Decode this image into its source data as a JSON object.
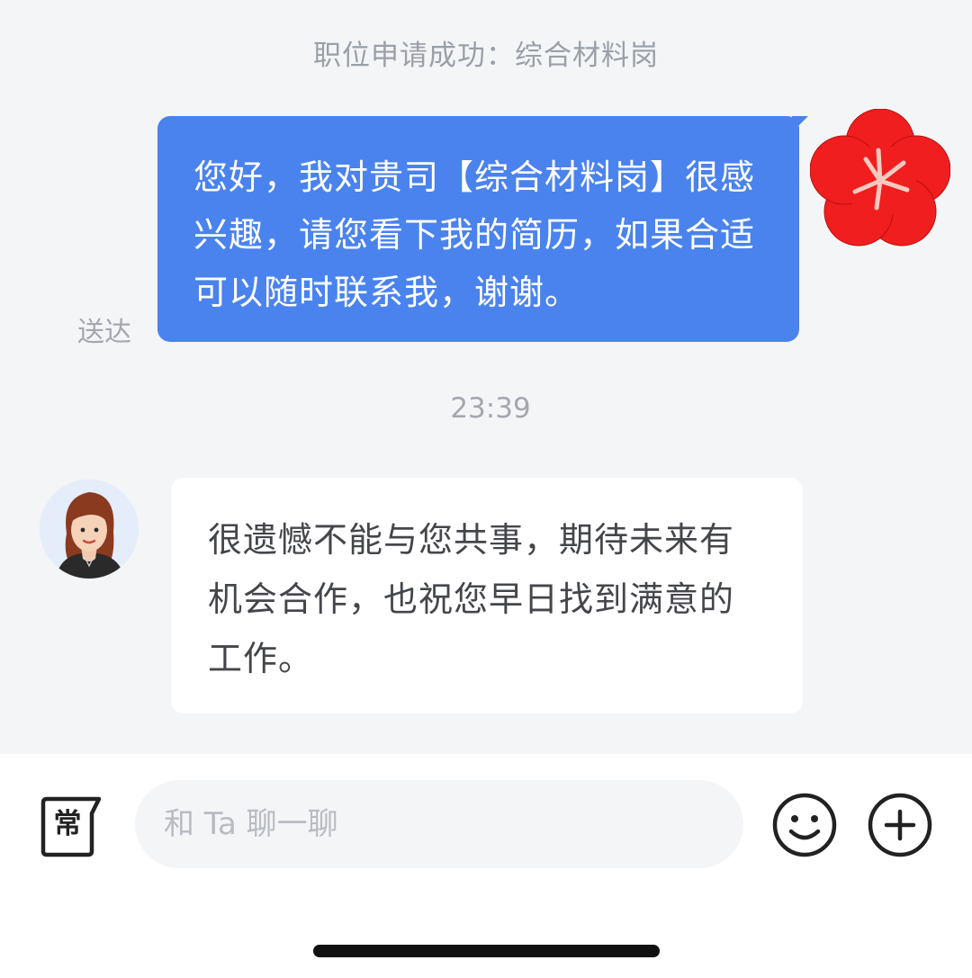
{
  "system_notice": "职位申请成功：综合材料岗",
  "messages": {
    "outgoing": {
      "text": "您好，我对贵司【综合材料岗】很感兴趣，请您看下我的简历，如果合适可以随时联系我，谢谢。",
      "status": "送达",
      "color": "#4a83ee"
    },
    "timestamp": "23:39",
    "incoming": {
      "text": "很遗憾不能与您共事，期待未来有机会合作，也祝您早日找到满意的工作。"
    }
  },
  "input_bar": {
    "quick_reply_label": "常",
    "placeholder": "和 Ta 聊一聊",
    "emoji_icon": "smiley-icon",
    "more_icon": "plus-circle-icon"
  },
  "colors": {
    "background": "#f4f5f7",
    "accent": "#4a83ee",
    "avatar_red": "#f01e1e"
  }
}
